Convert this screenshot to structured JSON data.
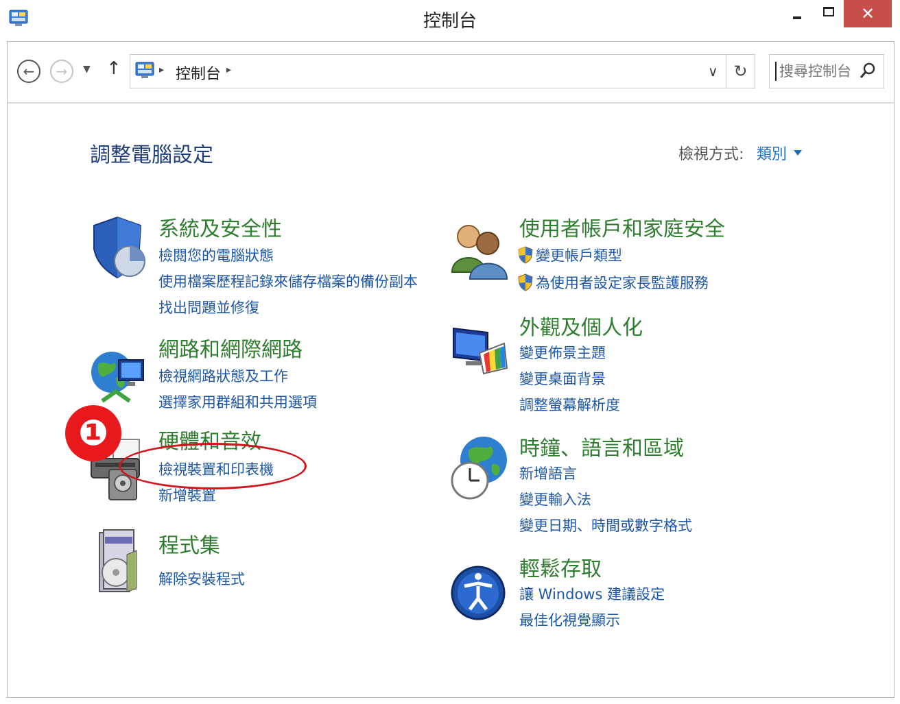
{
  "window": {
    "title": "控制台",
    "minimize_symbol": "",
    "close_symbol": "✕"
  },
  "nav": {
    "back_symbol": "←",
    "forward_symbol": "→",
    "dropdown_symbol": "▼",
    "up_symbol": "↑",
    "breadcrumb": [
      "控制台"
    ],
    "breadcrumb_sep": "▸",
    "address_dropdown_symbol": "∨",
    "refresh_symbol": "↻",
    "search_placeholder": "搜尋控制台"
  },
  "main": {
    "heading": "調整電腦設定",
    "view_by_label": "檢視方式:",
    "view_by_value": "類別"
  },
  "categories": [
    {
      "title": "系統及安全性",
      "links": [
        "檢閱您的電腦狀態",
        "使用檔案歷程記錄來儲存檔案的備份副本",
        "找出問題並修復"
      ]
    },
    {
      "title": "網路和網際網路",
      "links": [
        "檢視網路狀態及工作",
        "選擇家用群組和共用選項"
      ]
    },
    {
      "title": "硬體和音效",
      "links": [
        "檢視裝置和印表機",
        "新增裝置"
      ]
    },
    {
      "title": "程式集",
      "links": [
        "解除安裝程式"
      ]
    },
    {
      "title": "使用者帳戶和家庭安全",
      "links": [
        "變更帳戶類型",
        "為使用者設定家長監護服務"
      ]
    },
    {
      "title": "外觀及個人化",
      "links": [
        "變更佈景主題",
        "變更桌面背景",
        "調整螢幕解析度"
      ]
    },
    {
      "title": "時鐘、語言和區域",
      "links": [
        "新增語言",
        "變更輸入法",
        "變更日期、時間或數字格式"
      ]
    },
    {
      "title": "輕鬆存取",
      "links": [
        "讓 Windows 建議設定",
        "最佳化視覺顯示"
      ]
    }
  ],
  "annotation": {
    "step": "❶"
  },
  "colors": {
    "category_title": "#2f7d2f",
    "link": "#1d57a6",
    "heading": "#1e3c78",
    "close_button": "#c74f4a",
    "annotation": "#e8191c"
  },
  "icons": [
    "control-panel-icon",
    "shield-security-icon",
    "network-globe-icon",
    "printer-icon",
    "programs-disc-icon",
    "users-icon",
    "uac-shield-icon",
    "display-palette-icon",
    "clock-globe-icon",
    "ease-of-access-icon",
    "search-icon"
  ]
}
